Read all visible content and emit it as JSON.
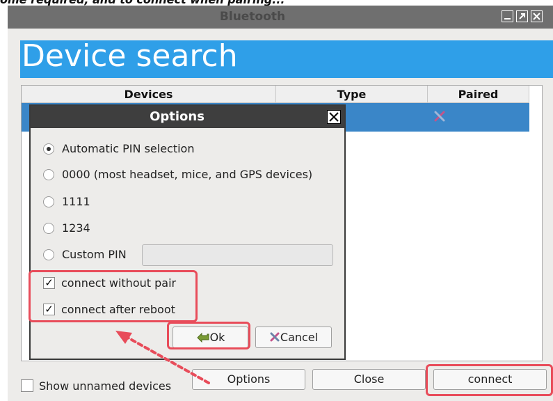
{
  "top_cropped_text": "ome required, and to connect when pairing...",
  "window": {
    "title": "Bluetooth"
  },
  "header": {
    "title": "Device search"
  },
  "table": {
    "columns": [
      "Devices",
      "Type",
      "Paired"
    ]
  },
  "options_dialog": {
    "title": "Options",
    "radio_options": [
      {
        "label": "Automatic PIN selection",
        "checked": true
      },
      {
        "label": "0000 (most headset, mice, and GPS devices)",
        "checked": false
      },
      {
        "label": "1111",
        "checked": false
      },
      {
        "label": "1234",
        "checked": false
      },
      {
        "label": "Custom PIN",
        "checked": false
      }
    ],
    "custom_pin_value": "",
    "checkboxes": [
      {
        "label": "connect without pair",
        "checked": true
      },
      {
        "label": "connect after reboot",
        "checked": true
      }
    ],
    "ok_label": "Ok",
    "cancel_label": "Cancel"
  },
  "bottom": {
    "show_unnamed_label": "Show unnamed devices",
    "show_unnamed_checked": false,
    "options_label": "Options",
    "close_label": "Close",
    "connect_label": "connect"
  },
  "colors": {
    "header_blue": "#2f9fe8",
    "selection_blue": "#3a86c8",
    "highlight_red": "#e84c5a"
  }
}
